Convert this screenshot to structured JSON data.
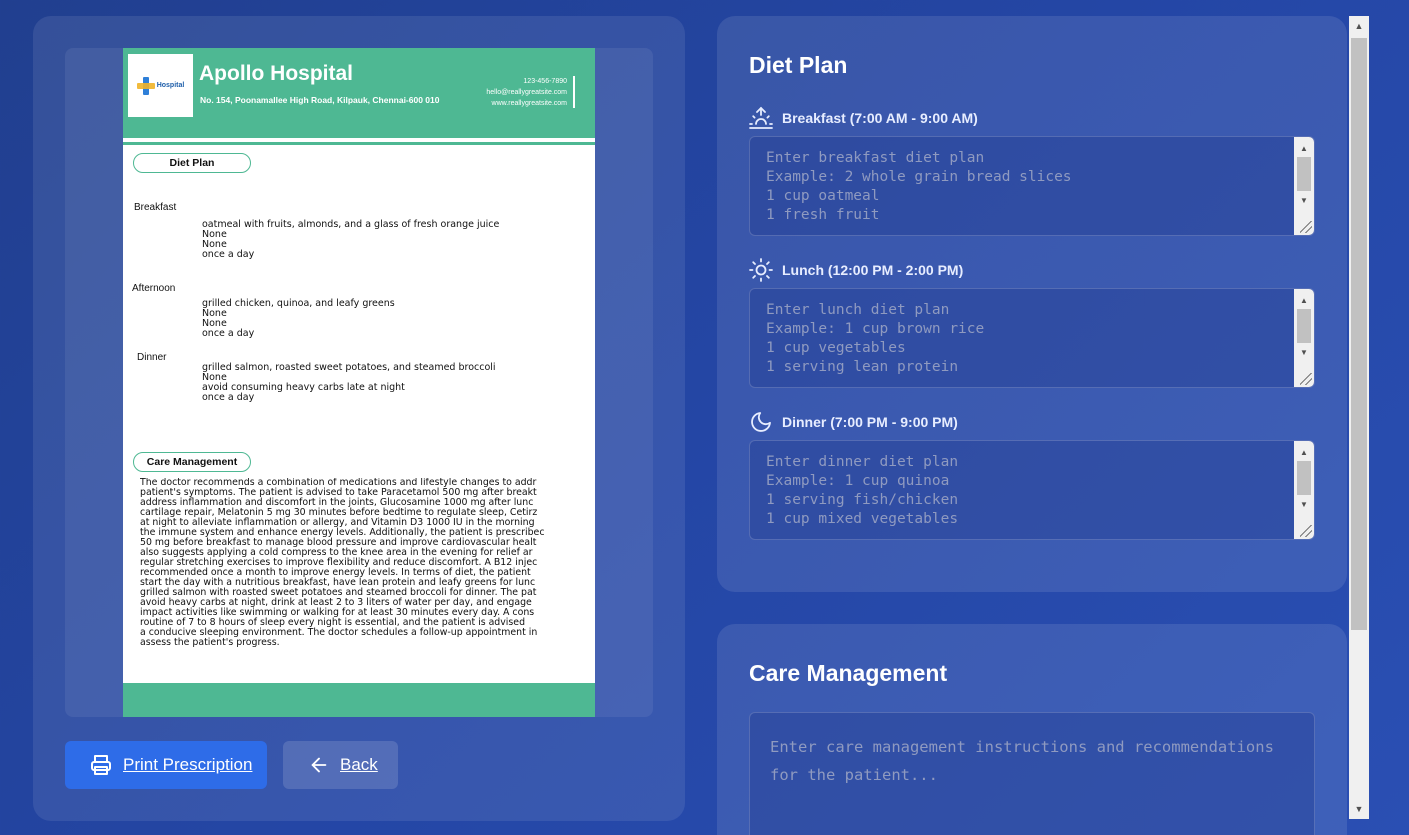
{
  "preview": {
    "hospital": {
      "logo_text": "Hospital",
      "name": "Apollo Hospital",
      "address": "No. 154, Poonamallee High Road, Kilpauk, Chennai-600 010",
      "phone": "123-456-7890",
      "email": "hello@reallygreatsite.com",
      "website": "www.reallygreatsite.com"
    },
    "diet_section_title": "Diet Plan",
    "meals": [
      {
        "label": "Breakfast",
        "lines": [
          "oatmeal with fruits, almonds, and a glass of fresh orange juice",
          "None",
          "None",
          "once a day"
        ]
      },
      {
        "label": "Afternoon",
        "lines": [
          "grilled chicken, quinoa, and leafy greens",
          "None",
          "None",
          "once a day"
        ]
      },
      {
        "label": "Dinner",
        "lines": [
          "grilled salmon, roasted sweet potatoes, and steamed broccoli",
          "None",
          "avoid consuming heavy carbs late at night",
          "once a day"
        ]
      }
    ],
    "care_section_title": "Care Management",
    "care_text": "The doctor recommends a combination of medications and lifestyle changes to addr\npatient's symptoms. The patient is advised to take Paracetamol 500 mg after breakt\naddress inflammation and discomfort in the joints, Glucosamine 1000 mg after lunc\ncartilage repair, Melatonin 5 mg 30 minutes before bedtime to regulate sleep, Cetirz\nat night to alleviate inflammation or allergy, and Vitamin D3 1000 IU in the morning\nthe immune system and enhance energy levels. Additionally, the patient is prescribec\n50 mg before breakfast to manage blood pressure and improve cardiovascular healt\nalso suggests applying a cold compress to the knee area in the evening for relief ar\nregular stretching exercises to improve flexibility and reduce discomfort. A B12 injec\nrecommended once a month to improve energy levels. In terms of diet, the patient\nstart the day with a nutritious breakfast, have lean protein and leafy greens for lunc\ngrilled salmon with roasted sweet potatoes and steamed broccoli for dinner. The pat\navoid heavy carbs at night, drink at least 2 to 3 liters of water per day, and engage\nimpact activities like swimming or walking for at least 30 minutes every day. A cons\nroutine of 7 to 8 hours of sleep every night is essential, and the patient is advised\na conducive sleeping environment. The doctor schedules a follow-up appointment in\nassess the patient's progress."
  },
  "buttons": {
    "print_label": "Print Prescription",
    "back_label": "Back"
  },
  "diet_plan": {
    "title": "Diet Plan",
    "breakfast": {
      "label": "Breakfast (7:00 AM - 9:00 AM)",
      "placeholder": "Enter breakfast diet plan\nExample: 2 whole grain bread slices\n1 cup oatmeal\n1 fresh fruit"
    },
    "lunch": {
      "label": "Lunch (12:00 PM - 2:00 PM)",
      "placeholder": "Enter lunch diet plan\nExample: 1 cup brown rice\n1 cup vegetables\n1 serving lean protein"
    },
    "dinner": {
      "label": "Dinner (7:00 PM - 9:00 PM)",
      "placeholder": "Enter dinner diet plan\nExample: 1 cup quinoa\n1 serving fish/chicken\n1 cup mixed vegetables"
    }
  },
  "care_management": {
    "title": "Care Management",
    "placeholder": "Enter care management instructions and recommendations for the patient..."
  },
  "icons": {
    "print": "printer-icon",
    "back": "arrow-left-icon",
    "breakfast": "sunrise-icon",
    "lunch": "sun-icon",
    "dinner": "moon-icon"
  },
  "colors": {
    "accent_green": "#4eb893",
    "primary_button": "#2e6ce8",
    "background": "#2446a5"
  }
}
